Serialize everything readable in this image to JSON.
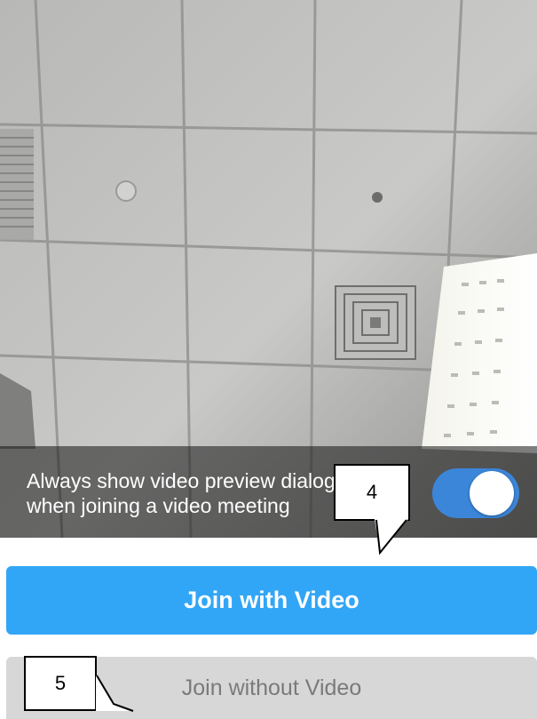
{
  "preview": {
    "option_text": "Always show video preview dialog when joining a video meeting",
    "toggle_on": true,
    "accent_color": "#3b86d9"
  },
  "buttons": {
    "join_with_video": "Join with Video",
    "join_without_video": "Join without Video",
    "primary_color": "#32a6f6",
    "secondary_color": "#d7d7d7"
  },
  "callouts": {
    "first": "4",
    "second": "5"
  }
}
